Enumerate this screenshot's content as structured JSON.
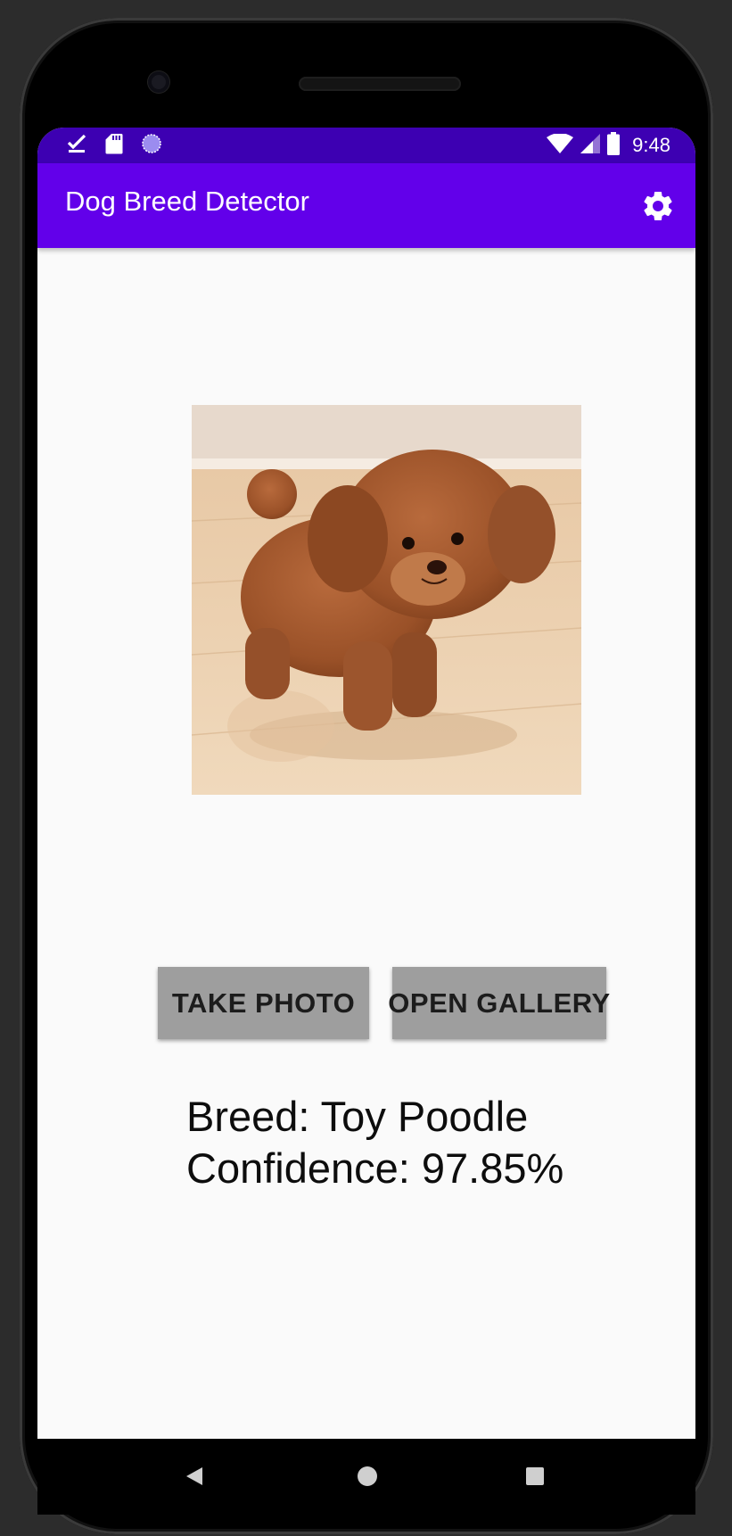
{
  "status_bar": {
    "time": "9:48",
    "icons": [
      "download-done-icon",
      "sd-card-icon",
      "sync-circle-icon",
      "wifi-icon",
      "signal-icon",
      "battery-icon"
    ]
  },
  "app_bar": {
    "title": "Dog Breed Detector",
    "settings_icon": "gear-icon"
  },
  "photo": {
    "subject": "dog-photo"
  },
  "buttons": {
    "take_photo": "TAKE PHOTO",
    "open_gallery": "OPEN GALLERY"
  },
  "result": {
    "breed_line": "Breed: Toy Poodle",
    "confidence_line": "Confidence: 97.85%"
  },
  "nav_bar": {
    "back_icon": "back-triangle-icon",
    "home_icon": "home-circle-icon",
    "recents_icon": "recents-square-icon"
  },
  "colors": {
    "status_bar": "#3d00b2",
    "app_bar": "#6200ea",
    "button": "#9e9e9e",
    "background": "#fafafa"
  }
}
